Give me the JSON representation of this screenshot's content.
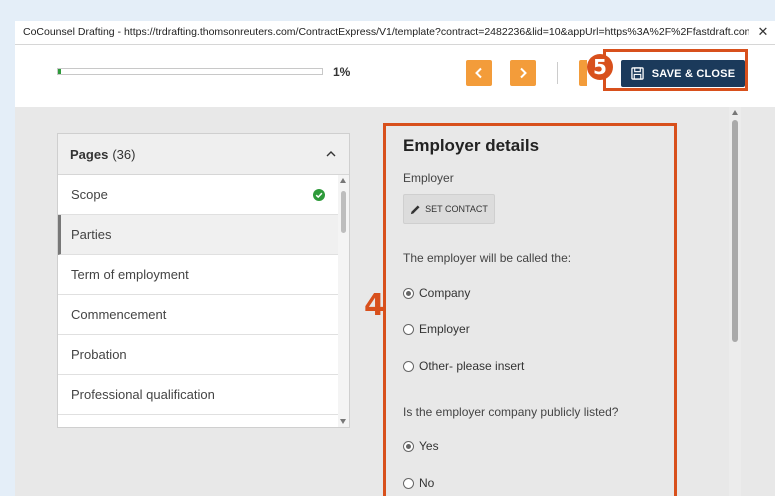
{
  "window": {
    "title": "CoCounsel Drafting - https://trdrafting.thomsonreuters.com/ContractExpress/V1/template?contract=2482236&lid=10&appUrl=https%3A%2F%2Ffastdraft.contrac...",
    "close_glyph": "✕"
  },
  "toolbar": {
    "progress_value": 0.01,
    "progress_label": "1%",
    "prev_icon": "chevron-left-icon",
    "next_icon": "chevron-right-icon",
    "save_label": "SAVE & CLOSE",
    "save_icon": "floppy-disk-icon",
    "accent_color": "#f39c3a",
    "save_color": "#1b3a5b"
  },
  "callouts": {
    "five": "5",
    "four": "4",
    "color": "#d8501c"
  },
  "pages": {
    "title": "Pages",
    "count": "(36)",
    "items": [
      {
        "label": "Scope",
        "complete": true
      },
      {
        "label": "Parties",
        "active": true
      },
      {
        "label": "Term of employment"
      },
      {
        "label": "Commencement"
      },
      {
        "label": "Probation"
      },
      {
        "label": "Professional qualification"
      }
    ]
  },
  "form": {
    "title": "Employer details",
    "employer_label": "Employer",
    "set_contact_label": "SET CONTACT",
    "called_question": "The employer will be called the:",
    "called_options": [
      {
        "label": "Company",
        "selected": true
      },
      {
        "label": "Employer",
        "selected": false
      },
      {
        "label": "Other- please insert",
        "selected": false
      }
    ],
    "listed_question": "Is the employer company publicly listed?",
    "listed_options": [
      {
        "label": "Yes",
        "selected": true
      },
      {
        "label": "No",
        "selected": false
      }
    ]
  }
}
